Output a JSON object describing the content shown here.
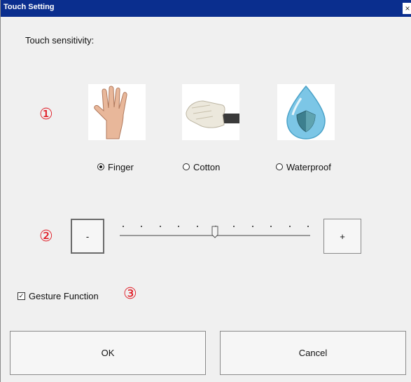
{
  "window": {
    "title": "Touch Setting",
    "close_glyph": "×"
  },
  "sensitivity": {
    "label": "Touch sensitivity:",
    "options": [
      {
        "label": "Finger",
        "icon": "hand-icon",
        "selected": true
      },
      {
        "label": "Cotton",
        "icon": "cotton-glove-icon",
        "selected": false
      },
      {
        "label": "Waterproof",
        "icon": "water-drop-shield-icon",
        "selected": false
      }
    ]
  },
  "slider": {
    "minus_label": "-",
    "plus_label": "+",
    "tick_count": 11,
    "value_fraction": 0.5
  },
  "gesture": {
    "label": "Gesture Function",
    "checked": true,
    "check_glyph": "✓"
  },
  "actions": {
    "ok_label": "OK",
    "cancel_label": "Cancel"
  },
  "annotations": {
    "marker_1": "①",
    "marker_2": "②",
    "marker_3": "③"
  },
  "colors": {
    "titlebar": "#0a2e8e",
    "marker": "#e0141e",
    "window_bg": "#f0f0f0"
  }
}
